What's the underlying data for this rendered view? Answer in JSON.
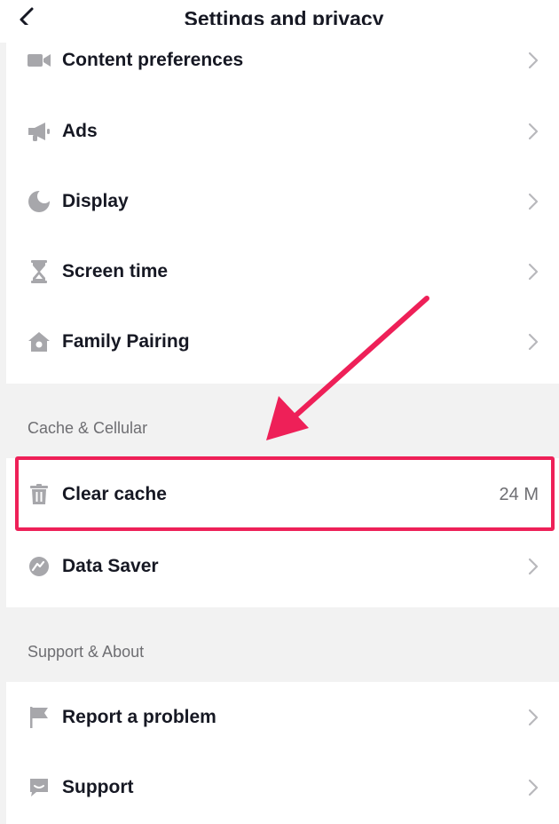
{
  "header": {
    "title": "Settings and privacy"
  },
  "groups": {
    "general": [
      {
        "label": "Content preferences",
        "icon": "video-camera-icon"
      },
      {
        "label": "Ads",
        "icon": "megaphone-icon"
      },
      {
        "label": "Display",
        "icon": "moon-icon"
      },
      {
        "label": "Screen time",
        "icon": "hourglass-icon"
      },
      {
        "label": "Family Pairing",
        "icon": "house-icon"
      }
    ],
    "cache": {
      "section_title": "Cache & Cellular",
      "items": [
        {
          "label": "Clear cache",
          "value": "24 M",
          "icon": "trash-icon"
        },
        {
          "label": "Data Saver",
          "icon": "data-saver-icon"
        }
      ]
    },
    "support": {
      "section_title": "Support & About",
      "items": [
        {
          "label": "Report a problem",
          "icon": "flag-icon"
        },
        {
          "label": "Support",
          "icon": "chat-bubble-icon"
        }
      ]
    }
  },
  "colors": {
    "highlight": "#ee2058",
    "icon_gray": "#a7a7ab",
    "chevron_gray": "#b8b8bc"
  }
}
